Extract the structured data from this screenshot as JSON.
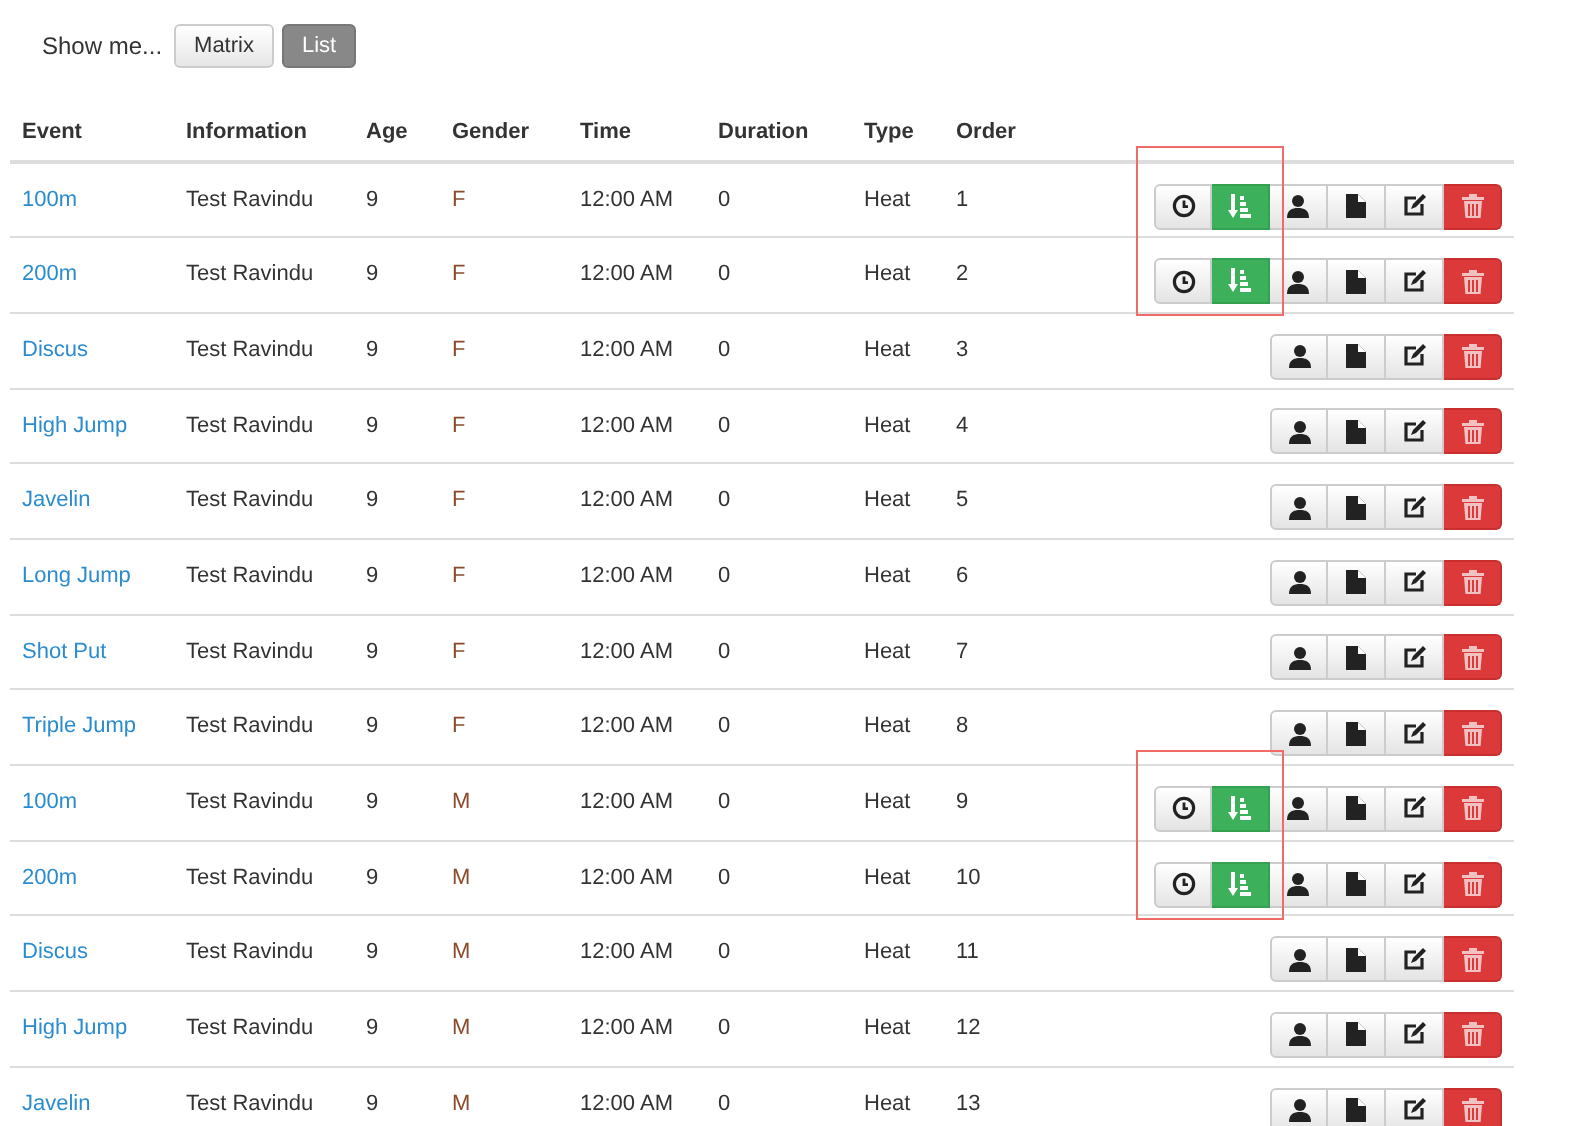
{
  "view_switch": {
    "label": "Show me...",
    "options": [
      {
        "label": "Matrix",
        "selected": false
      },
      {
        "label": "List",
        "selected": true
      }
    ]
  },
  "table": {
    "columns": [
      "Event",
      "Information",
      "Age",
      "Gender",
      "Time",
      "Duration",
      "Type",
      "Order"
    ],
    "rows": [
      {
        "event": "100m",
        "information": "Test Ravindu",
        "age": "9",
        "gender": "F",
        "time": "12:00 AM",
        "duration": "0",
        "type": "Heat",
        "order": "1",
        "timing": true,
        "highlighted": true
      },
      {
        "event": "200m",
        "information": "Test Ravindu",
        "age": "9",
        "gender": "F",
        "time": "12:00 AM",
        "duration": "0",
        "type": "Heat",
        "order": "2",
        "timing": true,
        "highlighted": true
      },
      {
        "event": "Discus",
        "information": "Test Ravindu",
        "age": "9",
        "gender": "F",
        "time": "12:00 AM",
        "duration": "0",
        "type": "Heat",
        "order": "3",
        "timing": false,
        "highlighted": false
      },
      {
        "event": "High Jump",
        "information": "Test Ravindu",
        "age": "9",
        "gender": "F",
        "time": "12:00 AM",
        "duration": "0",
        "type": "Heat",
        "order": "4",
        "timing": false,
        "highlighted": false
      },
      {
        "event": "Javelin",
        "information": "Test Ravindu",
        "age": "9",
        "gender": "F",
        "time": "12:00 AM",
        "duration": "0",
        "type": "Heat",
        "order": "5",
        "timing": false,
        "highlighted": false
      },
      {
        "event": "Long Jump",
        "information": "Test Ravindu",
        "age": "9",
        "gender": "F",
        "time": "12:00 AM",
        "duration": "0",
        "type": "Heat",
        "order": "6",
        "timing": false,
        "highlighted": false
      },
      {
        "event": "Shot Put",
        "information": "Test Ravindu",
        "age": "9",
        "gender": "F",
        "time": "12:00 AM",
        "duration": "0",
        "type": "Heat",
        "order": "7",
        "timing": false,
        "highlighted": false
      },
      {
        "event": "Triple Jump",
        "information": "Test Ravindu",
        "age": "9",
        "gender": "F",
        "time": "12:00 AM",
        "duration": "0",
        "type": "Heat",
        "order": "8",
        "timing": false,
        "highlighted": false
      },
      {
        "event": "100m",
        "information": "Test Ravindu",
        "age": "9",
        "gender": "M",
        "time": "12:00 AM",
        "duration": "0",
        "type": "Heat",
        "order": "9",
        "timing": true,
        "highlighted": true
      },
      {
        "event": "200m",
        "information": "Test Ravindu",
        "age": "9",
        "gender": "M",
        "time": "12:00 AM",
        "duration": "0",
        "type": "Heat",
        "order": "10",
        "timing": true,
        "highlighted": true
      },
      {
        "event": "Discus",
        "information": "Test Ravindu",
        "age": "9",
        "gender": "M",
        "time": "12:00 AM",
        "duration": "0",
        "type": "Heat",
        "order": "11",
        "timing": false,
        "highlighted": false
      },
      {
        "event": "High Jump",
        "information": "Test Ravindu",
        "age": "9",
        "gender": "M",
        "time": "12:00 AM",
        "duration": "0",
        "type": "Heat",
        "order": "12",
        "timing": false,
        "highlighted": false
      },
      {
        "event": "Javelin",
        "information": "Test Ravindu",
        "age": "9",
        "gender": "M",
        "time": "12:00 AM",
        "duration": "0",
        "type": "Heat",
        "order": "13",
        "timing": false,
        "highlighted": false
      }
    ]
  }
}
